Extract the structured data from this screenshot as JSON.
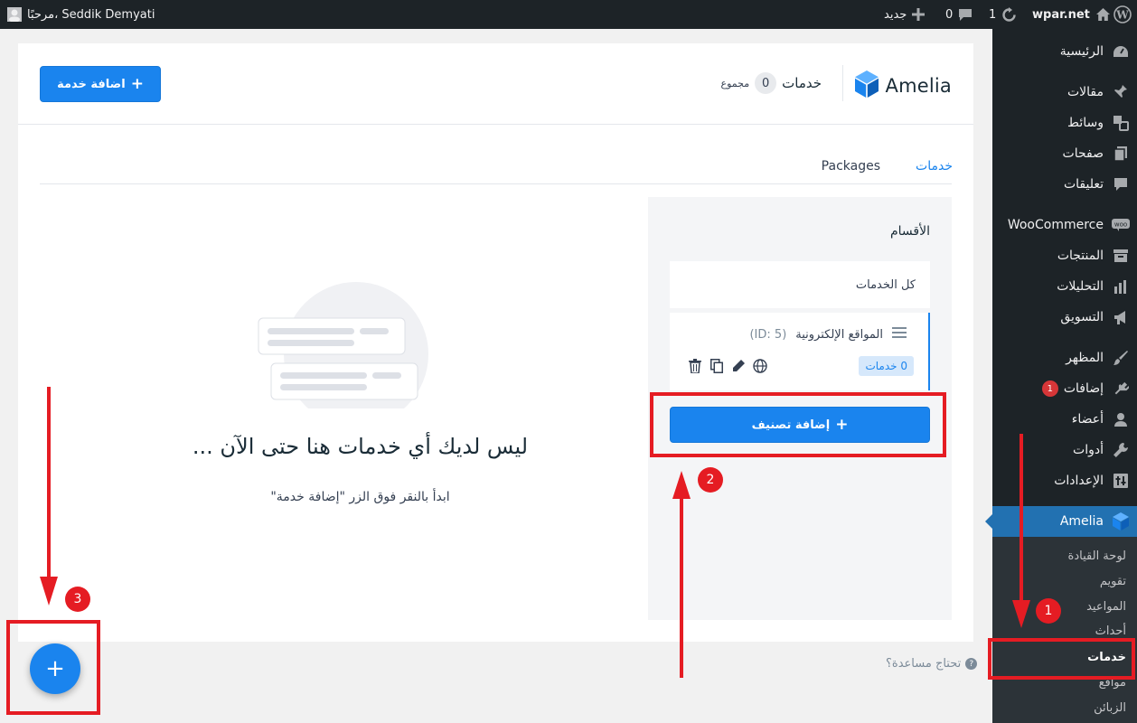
{
  "colors": {
    "accent": "#1a84ee",
    "wp_dark": "#1d2327",
    "wp_active": "#2271b1",
    "annotation": "#e51c23"
  },
  "admin_bar": {
    "user_greeting": "مرحبًا، Seddik Demyati",
    "site_name": "wpar.net",
    "updates_count": "1",
    "comments_count": "0",
    "new_label": "جديد"
  },
  "sidebar": {
    "items": [
      {
        "label": "الرئيسية",
        "icon": "dashboard-icon"
      },
      {
        "label": "مقالات",
        "icon": "pin-icon"
      },
      {
        "label": "وسائط",
        "icon": "media-icon"
      },
      {
        "label": "صفحات",
        "icon": "pages-icon"
      },
      {
        "label": "تعليقات",
        "icon": "comments-icon"
      },
      {
        "label": "WooCommerce",
        "icon": "woocommerce-icon"
      },
      {
        "label": "المنتجات",
        "icon": "archive-icon"
      },
      {
        "label": "التحليلات",
        "icon": "chart-icon"
      },
      {
        "label": "التسويق",
        "icon": "megaphone-icon"
      },
      {
        "label": "المظهر",
        "icon": "brush-icon"
      },
      {
        "label": "إضافات",
        "icon": "plugin-icon",
        "badge": "1"
      },
      {
        "label": "أعضاء",
        "icon": "user-icon"
      },
      {
        "label": "أدوات",
        "icon": "wrench-icon"
      },
      {
        "label": "الإعدادات",
        "icon": "settings-icon"
      },
      {
        "label": "Amelia",
        "icon": "amelia-icon"
      }
    ],
    "submenu": [
      "لوحة القيادة",
      "تقويم",
      "المواعيد",
      "أحداث",
      "خدمات",
      "مواقع",
      "الزبائن"
    ]
  },
  "header": {
    "logo_text": "Amelia",
    "title": "خدمات",
    "count": "0",
    "total_label": "مجموع",
    "add_service_label": "اضافة خدمة"
  },
  "tabs": {
    "services": "خدمات",
    "packages": "Packages"
  },
  "categories": {
    "title": "الأقسام",
    "all_label": "كل الخدمات",
    "items": [
      {
        "name": "المواقع الإلكترونية",
        "id_text": "(ID: 5)",
        "services_badge": "0 خدمات"
      }
    ],
    "add_button_label": "إضافة تصنيف"
  },
  "empty_state": {
    "title": "ليس لديك أي خدمات هنا حتى الآن ...",
    "subtitle": "ابدأ بالنقر فوق الزر \"إضافة خدمة\""
  },
  "help": {
    "label": "تحتاج مساعدة؟",
    "icon_glyph": "?"
  },
  "fab": {
    "glyph": "+"
  },
  "annotations": [
    "1",
    "2",
    "3"
  ]
}
